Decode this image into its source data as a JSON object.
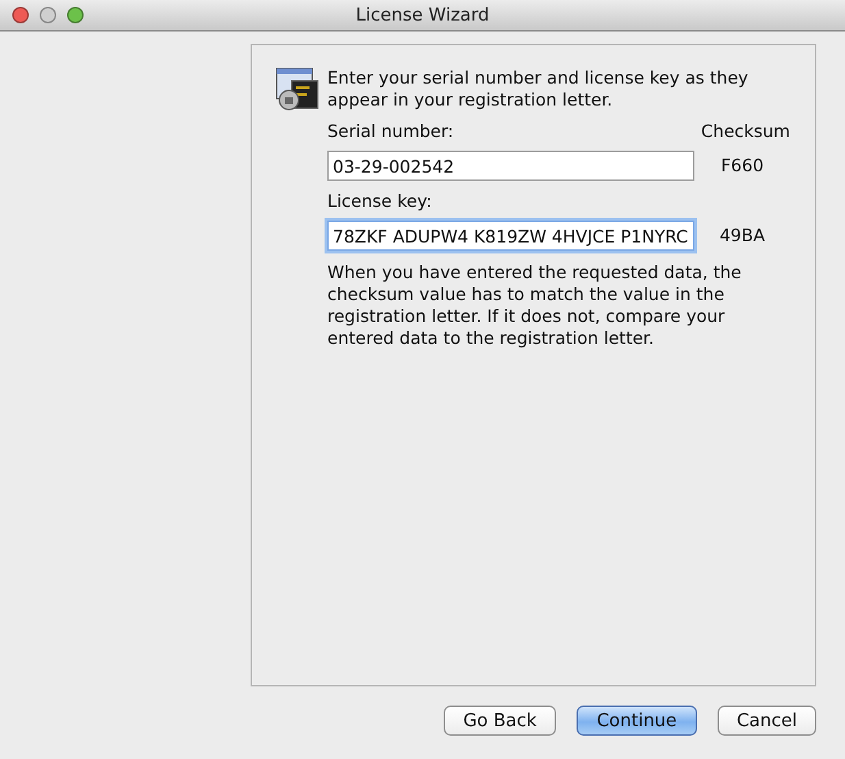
{
  "window": {
    "title": "License Wizard"
  },
  "intro": "Enter your serial number and license key as they appear in your registration letter.",
  "checksum_heading": "Checksum",
  "fields": [
    {
      "label": "Serial number:",
      "value": "03-29-002542",
      "checksum": "F660",
      "focused": false
    },
    {
      "label": "License key:",
      "value": "78ZKF ADUPW4 K819ZW 4HVJCE P1NYRC",
      "checksum": "49BA",
      "focused": true
    }
  ],
  "note": "When you have entered the requested data, the checksum value has to match the value in the registration letter.  If it does not, compare your entered data to the registration letter.",
  "buttons": [
    {
      "label": "Go Back",
      "default": false
    },
    {
      "label": "Continue",
      "default": true
    },
    {
      "label": "Cancel",
      "default": false
    }
  ]
}
